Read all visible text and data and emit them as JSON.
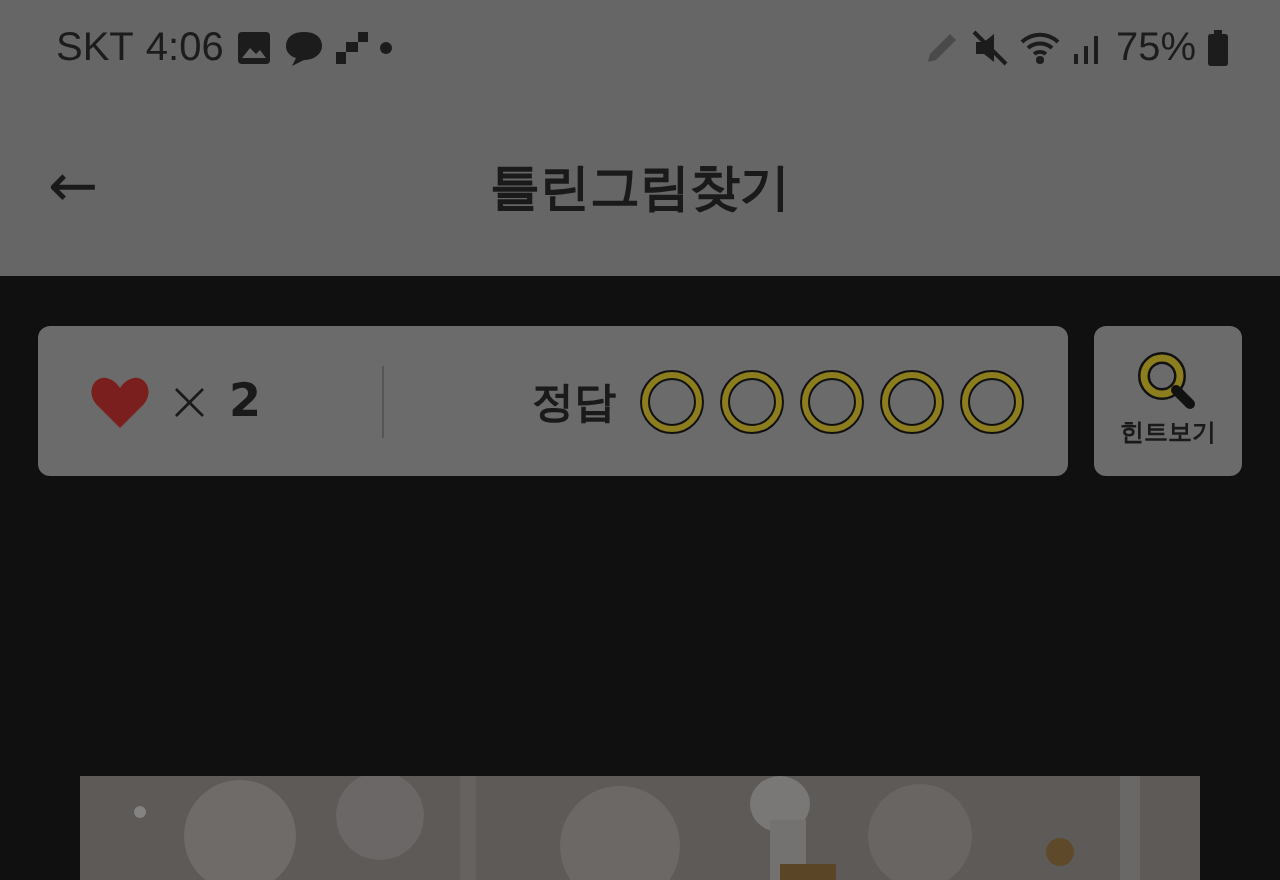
{
  "status_bar": {
    "carrier": "SKT",
    "time": "4:06",
    "battery": "75%"
  },
  "header": {
    "back": "←",
    "title": "틀린그림찾기"
  },
  "score_panel": {
    "lives_sign": "×",
    "lives": "2",
    "answer_label": "정답",
    "answers": [
      {
        "found": false
      },
      {
        "found": false
      },
      {
        "found": false
      },
      {
        "found": false
      },
      {
        "found": false
      }
    ]
  },
  "hint_button": {
    "label": "힌트보기"
  }
}
